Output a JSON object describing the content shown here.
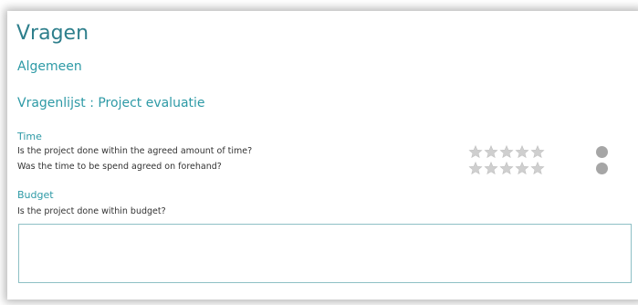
{
  "page": {
    "title": "Vragen"
  },
  "section": {
    "title": "Algemeen"
  },
  "questionnaire": {
    "title": "Vragenlijst : Project evaluatie"
  },
  "groups": [
    {
      "label": "Time",
      "questions": [
        {
          "text": "Is the project done within the agreed amount of time?",
          "rating": 0,
          "max_rating": 5
        },
        {
          "text": "Was the time to be spend agreed on forehand?",
          "rating": 0,
          "max_rating": 5
        }
      ]
    },
    {
      "label": "Budget",
      "questions": [
        {
          "text": "Is the project done within budget?",
          "answer": ""
        }
      ]
    }
  ],
  "colors": {
    "accent": "#2e9aa6",
    "star_empty": "#cfcfcf",
    "status_circle": "#a6a6a6"
  },
  "icons": {
    "rating": "star-icon",
    "status": "status-circle-icon"
  }
}
